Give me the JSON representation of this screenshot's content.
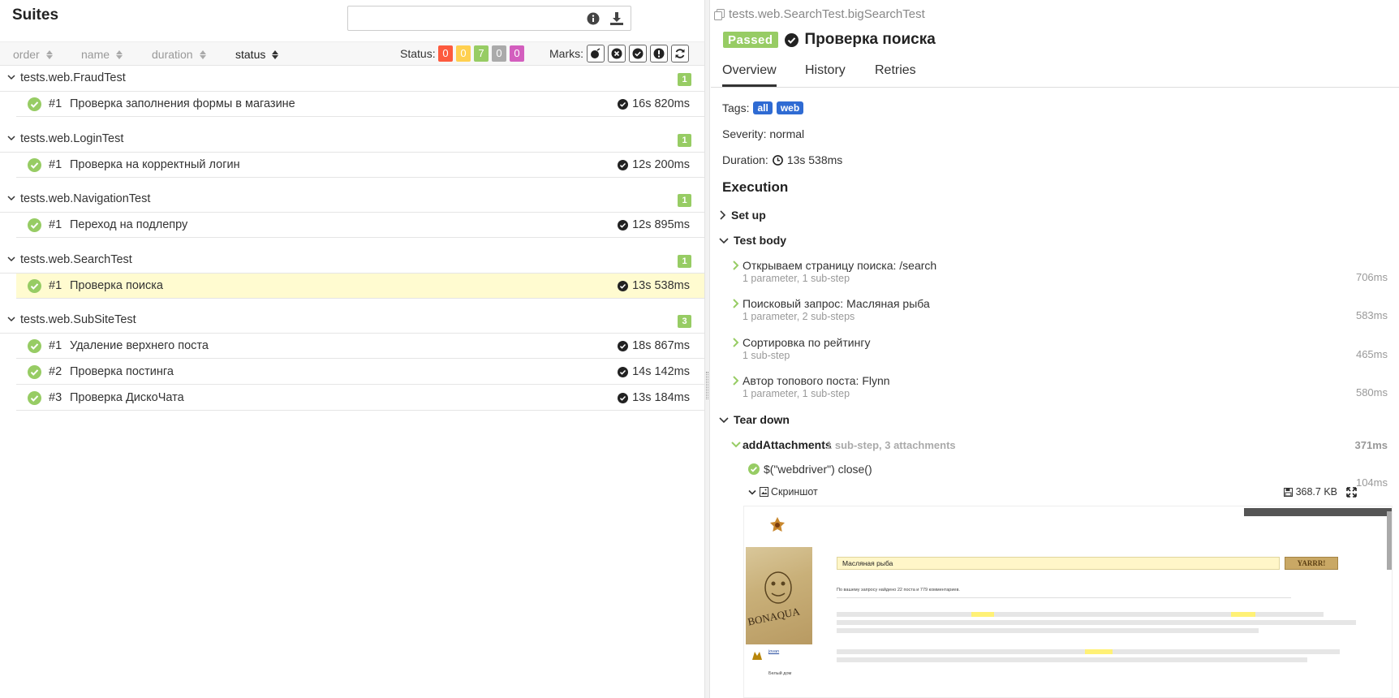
{
  "left": {
    "title": "Suites",
    "filter_placeholder": "",
    "sort_columns": [
      {
        "label": "order",
        "active": false
      },
      {
        "label": "name",
        "active": false
      },
      {
        "label": "duration",
        "active": false
      },
      {
        "label": "status",
        "active": true
      }
    ],
    "status_filter": {
      "label": "Status:",
      "counts": [
        {
          "value": "0",
          "color": "#fd5a3e"
        },
        {
          "value": "0",
          "color": "#ffd050"
        },
        {
          "value": "7",
          "color": "#97cc64"
        },
        {
          "value": "0",
          "color": "#aaaaaa"
        },
        {
          "value": "0",
          "color": "#d35ebe"
        }
      ]
    },
    "marks_label": "Marks:",
    "groups": [
      {
        "name": "tests.web.FraudTest",
        "count": "1",
        "tests": [
          {
            "num": "#1",
            "name": "Проверка заполнения формы в магазине",
            "duration": "16s 820ms",
            "selected": false
          }
        ]
      },
      {
        "name": "tests.web.LoginTest",
        "count": "1",
        "tests": [
          {
            "num": "#1",
            "name": "Проверка на корректный логин",
            "duration": "12s 200ms",
            "selected": false
          }
        ]
      },
      {
        "name": "tests.web.NavigationTest",
        "count": "1",
        "tests": [
          {
            "num": "#1",
            "name": "Переход на подлепру",
            "duration": "12s 895ms",
            "selected": false
          }
        ]
      },
      {
        "name": "tests.web.SearchTest",
        "count": "1",
        "tests": [
          {
            "num": "#1",
            "name": "Проверка поиска",
            "duration": "13s 538ms",
            "selected": true
          }
        ]
      },
      {
        "name": "tests.web.SubSiteTest",
        "count": "3",
        "tests": [
          {
            "num": "#1",
            "name": "Удаление верхнего поста",
            "duration": "18s 867ms",
            "selected": false
          },
          {
            "num": "#2",
            "name": "Проверка постинга",
            "duration": "14s 142ms",
            "selected": false
          },
          {
            "num": "#3",
            "name": "Проверка ДискоЧата",
            "duration": "13s 184ms",
            "selected": false
          }
        ]
      }
    ]
  },
  "right": {
    "full_name": "tests.web.SearchTest.bigSearchTest",
    "status": "Passed",
    "title": "Проверка поиска",
    "tabs": [
      "Overview",
      "History",
      "Retries"
    ],
    "tags_label": "Tags:",
    "tags": [
      "all",
      "web"
    ],
    "severity": "Severity: normal",
    "duration_label": "Duration:",
    "duration": "13s 538ms",
    "execution_title": "Execution",
    "setup_label": "Set up",
    "test_body_label": "Test body",
    "steps": [
      {
        "name": "Открываем страницу поиска: /search",
        "sub": "1 parameter, 1 sub-step",
        "duration": "706ms"
      },
      {
        "name": "Поисковый запрос: Масляная рыба",
        "sub": "1 parameter, 2 sub-steps",
        "duration": "583ms"
      },
      {
        "name": "Сортировка по рейтингу",
        "sub": "1 sub-step",
        "duration": "465ms"
      },
      {
        "name": "Автор топового поста: Flynn",
        "sub": "1 parameter, 1 sub-step",
        "duration": "580ms"
      }
    ],
    "teardown_label": "Tear down",
    "teardown_step": {
      "name": "addAttachments",
      "meta": "1 sub-step, 3 attachments",
      "duration": "371ms"
    },
    "close_step": {
      "name": "$(\"webdriver\") close()",
      "duration": "104ms"
    },
    "attachment": {
      "name": "Скриншот",
      "size": "368.7 KB"
    },
    "preview": {
      "search_text": "Масляная рыба",
      "button_text": "YARRR!",
      "result_summary": "По вашему запросу найдено 22 поста и 779 комментариев.",
      "brand_text": "BONAQUA",
      "user_name": "jovan",
      "home_label": "Белый дом"
    }
  },
  "colors": {
    "passed": "#97cc64",
    "selected_row": "#fffbd0",
    "tag": "#2f6bd3"
  }
}
